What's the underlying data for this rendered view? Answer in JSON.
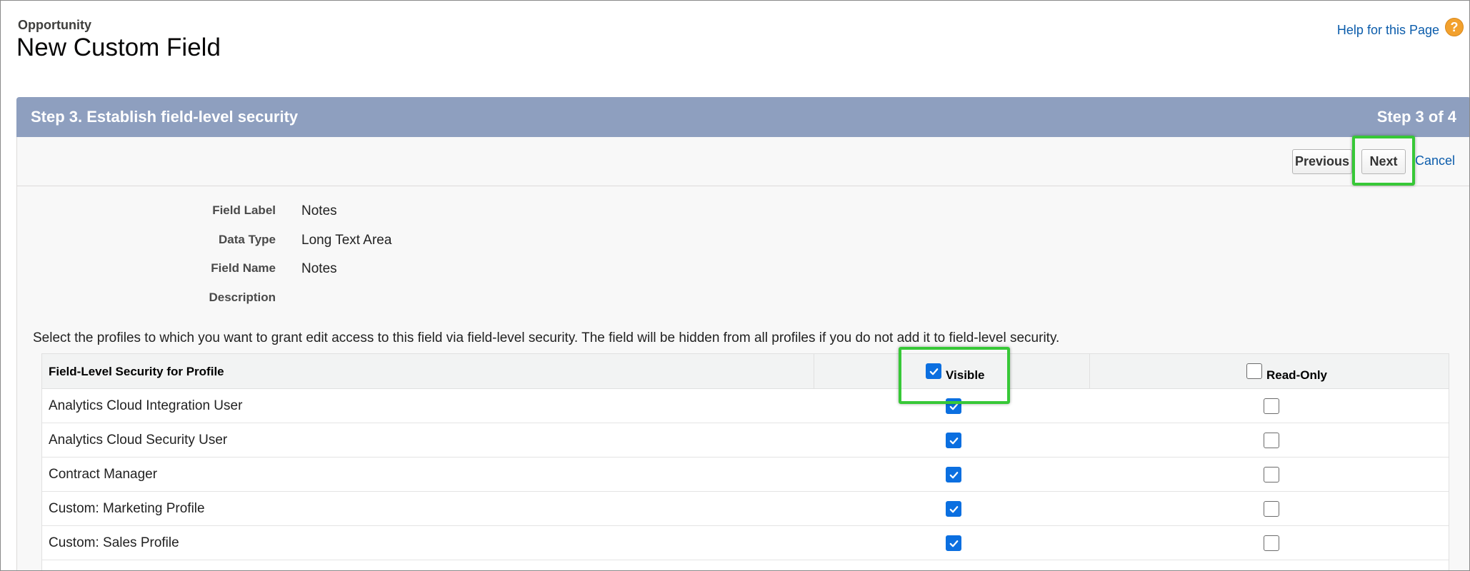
{
  "header": {
    "object_name": "Opportunity",
    "page_title": "New Custom Field",
    "help_link": "Help for this Page",
    "help_icon": "?"
  },
  "step": {
    "title": "Step 3. Establish field-level security",
    "progress": "Step 3 of 4"
  },
  "buttons": {
    "previous": "Previous",
    "next": "Next",
    "cancel": "Cancel"
  },
  "field_info": [
    {
      "label": "Field Label",
      "value": "Notes"
    },
    {
      "label": "Data Type",
      "value": "Long Text Area"
    },
    {
      "label": "Field Name",
      "value": "Notes"
    },
    {
      "label": "Description",
      "value": ""
    }
  ],
  "instruction": "Select the profiles to which you want to grant edit access to this field via field-level security. The field will be hidden from all profiles if you do not add it to field-level security.",
  "table": {
    "col_profile": "Field-Level Security for Profile",
    "col_visible": "Visible",
    "col_readonly": "Read-Only",
    "header_visible_checked": true,
    "header_readonly_checked": false,
    "rows": [
      {
        "profile": "Analytics Cloud Integration User",
        "visible": true,
        "read_only": false
      },
      {
        "profile": "Analytics Cloud Security User",
        "visible": true,
        "read_only": false
      },
      {
        "profile": "Contract Manager",
        "visible": true,
        "read_only": false
      },
      {
        "profile": "Custom: Marketing Profile",
        "visible": true,
        "read_only": false
      },
      {
        "profile": "Custom: Sales Profile",
        "visible": true,
        "read_only": false
      }
    ]
  },
  "colors": {
    "step_header_bg": "#8e9fbf",
    "link": "#0b5cab",
    "checkbox_checked": "#0b6fe0",
    "highlight": "#37c837"
  }
}
